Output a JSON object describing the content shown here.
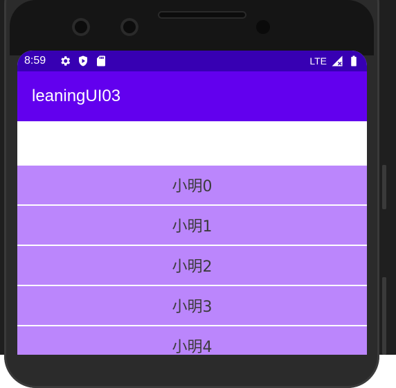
{
  "status_bar": {
    "time": "8:59",
    "left_icons": [
      "gear-icon",
      "shield-play-icon",
      "sd-card-icon"
    ],
    "network": "LTE",
    "right_icons": [
      "signal-icon",
      "battery-icon"
    ]
  },
  "app_bar": {
    "title": "leaningUI03"
  },
  "list": {
    "items": [
      {
        "label": "小明0"
      },
      {
        "label": "小明1"
      },
      {
        "label": "小明2"
      },
      {
        "label": "小明3"
      },
      {
        "label": "小明4"
      }
    ]
  },
  "colors": {
    "status_bar": "#3700b3",
    "app_bar": "#6200ee",
    "list_item_bg": "#bb86fc",
    "list_item_text": "#3b3b3b"
  }
}
